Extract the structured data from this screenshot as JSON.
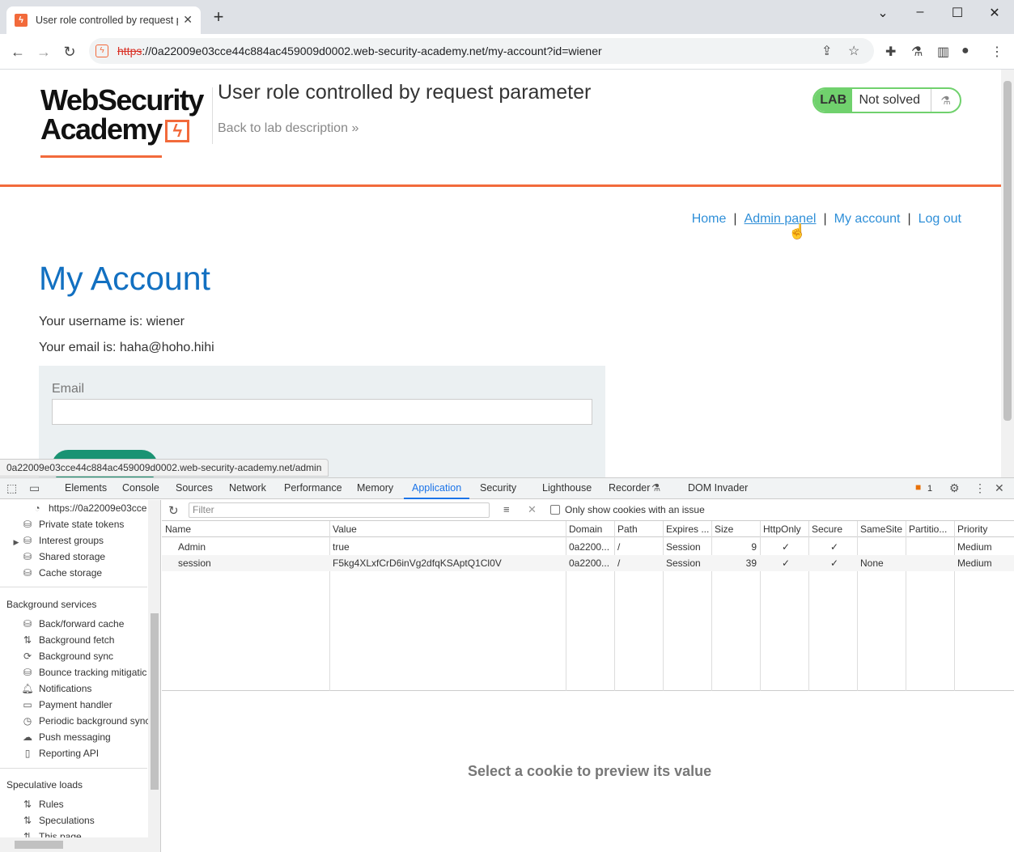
{
  "browser": {
    "tab_title": "User role controlled by request p",
    "url_scheme": "https",
    "url_rest": "://0a22009e03cce44c884ac459009d0002.web-security-academy.net/my-account?id=wiener"
  },
  "lab": {
    "logo_line1": "WebSecurity",
    "logo_line2": "Academy",
    "title": "User role controlled by request parameter",
    "back_link": "Back to lab description",
    "badge_lab": "LAB",
    "badge_status": "Not solved"
  },
  "nav": {
    "home": "Home",
    "admin": "Admin panel",
    "account": "My account",
    "logout": "Log out",
    "sep": "|"
  },
  "account": {
    "heading": "My Account",
    "username_line": "Your username is: wiener",
    "email_line": "Your email is: haha@hoho.hihi",
    "email_label": "Email"
  },
  "status_url": "0a22009e03cce44c884ac459009d0002.web-security-academy.net/admin",
  "devtools": {
    "tabs": [
      "Elements",
      "Console",
      "Sources",
      "Network",
      "Performance",
      "Memory",
      "Application",
      "Security",
      "Lighthouse",
      "Recorder",
      "DOM Invader"
    ],
    "issues_count": "1",
    "sidebar": {
      "origin": "https://0a22009e03cce",
      "storage_items": [
        "Private state tokens",
        "Interest groups",
        "Shared storage",
        "Cache storage"
      ],
      "bg_header": "Background services",
      "bg_items": [
        "Back/forward cache",
        "Background fetch",
        "Background sync",
        "Bounce tracking mitigatic",
        "Notifications",
        "Payment handler",
        "Periodic background sync",
        "Push messaging",
        "Reporting API"
      ],
      "spec_header": "Speculative loads",
      "spec_items": [
        "Rules",
        "Speculations",
        "This page"
      ]
    },
    "filter_placeholder": "Filter",
    "only_issue_label": "Only show cookies with an issue",
    "columns": [
      "Name",
      "Value",
      "Domain",
      "Path",
      "Expires ...",
      "Size",
      "HttpOnly",
      "Secure",
      "SameSite",
      "Partitio...",
      "Priority"
    ],
    "rows": [
      [
        "Admin",
        "true",
        "0a2200...",
        "/",
        "Session",
        "9",
        "✓",
        "✓",
        "",
        "",
        "Medium"
      ],
      [
        "session",
        "F5kg4XLxfCrD6inVg2dfqKSAptQ1Cl0V",
        "0a2200...",
        "/",
        "Session",
        "39",
        "✓",
        "✓",
        "None",
        "",
        "Medium"
      ]
    ],
    "preview_text": "Select a cookie to preview its value"
  },
  "colors": {
    "accent": "#f26a3b",
    "link": "#2f8fd8",
    "heading": "#1270c1",
    "lab_green": "#70d16d",
    "devtools_active": "#1a73e8"
  }
}
